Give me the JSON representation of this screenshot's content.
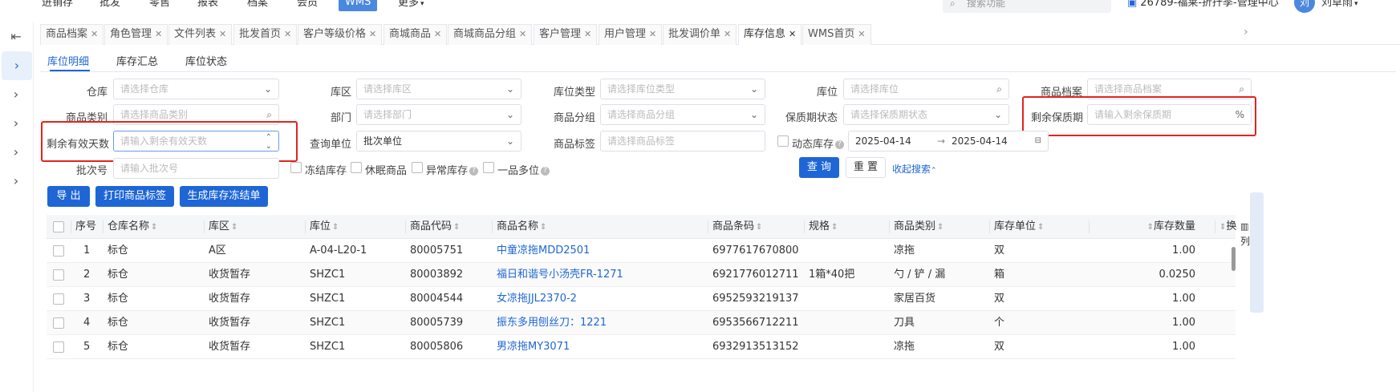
{
  "topnav": {
    "items": [
      "进销存",
      "批发",
      "零售",
      "报表",
      "档案",
      "会员",
      "WMS",
      "更多"
    ],
    "active_index": 6,
    "search_placeholder": "搜索功能",
    "company": "26789-福莱-折扦季-管理中心",
    "avatar_text": "刘",
    "user": "刘草雨"
  },
  "tabs": [
    {
      "label": "商品档案"
    },
    {
      "label": "角色管理"
    },
    {
      "label": "文件列表"
    },
    {
      "label": "批发首页"
    },
    {
      "label": "客户等级价格"
    },
    {
      "label": "商城商品"
    },
    {
      "label": "商城商品分组"
    },
    {
      "label": "客户管理"
    },
    {
      "label": "用户管理"
    },
    {
      "label": "批发调价单"
    },
    {
      "label": "库存信息"
    },
    {
      "label": "WMS首页"
    }
  ],
  "active_tab_index": 10,
  "subtabs": [
    "库位明细",
    "库存汇总",
    "库位状态"
  ],
  "form": {
    "warehouse": {
      "label": "仓库",
      "placeholder": "请选择仓库"
    },
    "area": {
      "label": "库区",
      "placeholder": "请选择库区"
    },
    "loc_type": {
      "label": "库位类型",
      "placeholder": "请选择库位类型"
    },
    "location": {
      "label": "库位",
      "placeholder": "请选择库位"
    },
    "product": {
      "label": "商品档案",
      "placeholder": "请选择商品档案"
    },
    "category": {
      "label": "商品类别",
      "placeholder": "请选择商品类别"
    },
    "dept": {
      "label": "部门",
      "placeholder": "请选择部门"
    },
    "group": {
      "label": "商品分组",
      "placeholder": "请选择商品分组"
    },
    "shelf_status": {
      "label": "保质期状态",
      "placeholder": "请选择保质期状态"
    },
    "remain_shelf": {
      "label": "剩余保质期",
      "placeholder": "请输入剩余保质期",
      "suffix": "%"
    },
    "remain_days": {
      "label": "剩余有效天数",
      "placeholder": "请输入剩余有效天数"
    },
    "query_unit": {
      "label": "查询单位",
      "value": "批次单位"
    },
    "tag": {
      "label": "商品标签",
      "placeholder": "请选择商品标签"
    },
    "dynamic_stock": {
      "label": "动态库存",
      "help": "?"
    },
    "date_start": "2025-04-14",
    "date_sep": "→",
    "date_end": "2025-04-14",
    "batch": {
      "label": "批次号",
      "placeholder": "请输入批次号"
    },
    "frozen": {
      "label": "冻结库存"
    },
    "dormant": {
      "label": "休眠商品"
    },
    "abnormal": {
      "label": "异常库存",
      "help": "?"
    },
    "multi_loc": {
      "label": "一品多位",
      "help": "?"
    },
    "query_btn": "查 询",
    "reset_btn": "重 置",
    "collapse_link": "收起搜索"
  },
  "actions": {
    "export": "导 出",
    "print_label": "打印商品标签",
    "gen_freeze": "生成库存冻结单"
  },
  "table": {
    "columns": [
      "序号",
      "仓库名称",
      "库区",
      "库位",
      "商品代码",
      "商品名称",
      "商品条码",
      "规格",
      "商品类别",
      "库存单位",
      "库存数量",
      "换"
    ],
    "rows": [
      [
        "1",
        "标仓",
        "A区",
        "A-04-L20-1",
        "80005751",
        "中童凉拖MDD2501",
        "6977617670800",
        "",
        "凉拖",
        "双",
        "1.00"
      ],
      [
        "2",
        "标仓",
        "收货暂存",
        "SHZC1",
        "80003892",
        "福日和谐号小汤壳FR-1271",
        "6921776012711",
        "1箱*40把",
        "勺 / 铲 / 漏",
        "箱",
        "0.0250"
      ],
      [
        "3",
        "标仓",
        "收货暂存",
        "SHZC1",
        "80004544",
        "女凉拖JJL2370-2",
        "6952593219137",
        "",
        "家居百货",
        "双",
        "1.00"
      ],
      [
        "4",
        "标仓",
        "收货暂存",
        "SHZC1",
        "80005739",
        "振东多用刨丝刀：1221",
        "6953566712211",
        "",
        "刀具",
        "个",
        "1.00"
      ],
      [
        "5",
        "标仓",
        "收货暂存",
        "SHZC1",
        "80005806",
        "男凉拖MY3071",
        "6932913513152",
        "",
        "凉拖",
        "双",
        "1.00"
      ]
    ]
  },
  "right_panel_label": "列"
}
